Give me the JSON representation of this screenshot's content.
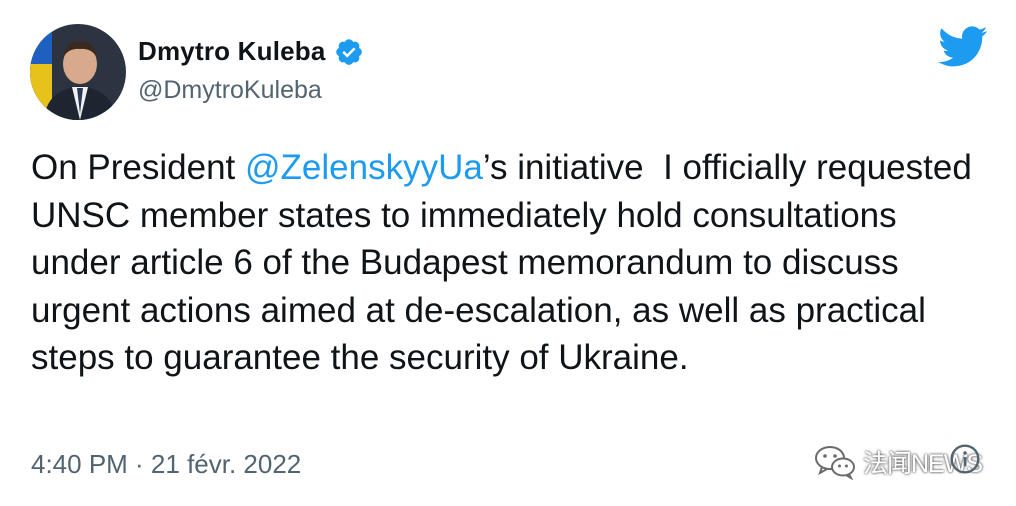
{
  "author": {
    "display_name": "Dmytro Kuleba",
    "handle": "@DmytroKuleba",
    "verified_icon": "verified-badge-icon"
  },
  "logo_icon": "twitter-bird-icon",
  "tweet": {
    "text_before": "On President ",
    "mention": "@ZelenskyyUa",
    "text_after": "’s initiative  I officially requested UNSC member states to immediately hold consultations under article 6 of the Budapest memorandum to discuss urgent actions aimed at de-escalation, as well as practical steps to guarantee the security of Ukraine.",
    "timestamp": "4:40 PM · 21 févr. 2022"
  },
  "watermark": {
    "icon": "wechat-icon",
    "text": "法闻NEWS"
  },
  "info_icon": "info-icon",
  "colors": {
    "text": "#0f1419",
    "secondary": "#536471",
    "accent": "#1d9bf0"
  }
}
